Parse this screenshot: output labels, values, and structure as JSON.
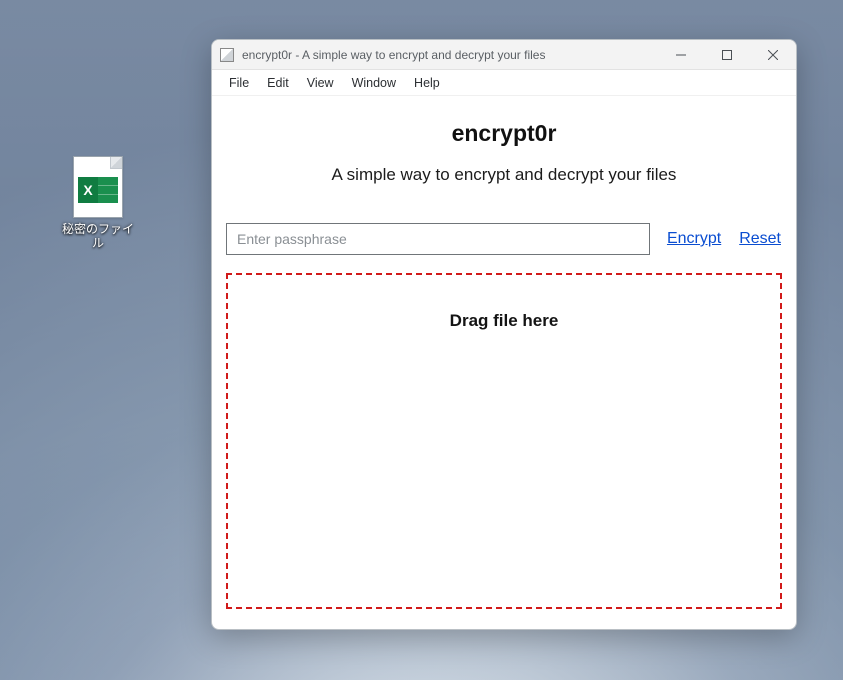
{
  "desktop": {
    "file_icon_letter": "X",
    "file_label": "秘密のファイル"
  },
  "window": {
    "title": "encrypt0r - A simple way to encrypt and decrypt your files",
    "controls": {
      "minimize": "minimize",
      "maximize": "maximize",
      "close": "close"
    }
  },
  "menubar": {
    "items": [
      "File",
      "Edit",
      "View",
      "Window",
      "Help"
    ]
  },
  "app": {
    "title": "encrypt0r",
    "subtitle": "A simple way to encrypt and decrypt your files",
    "passphrase_placeholder": "Enter passphrase",
    "passphrase_value": "",
    "encrypt_label": "Encrypt",
    "reset_label": "Reset",
    "dropzone_label": "Drag file here"
  }
}
